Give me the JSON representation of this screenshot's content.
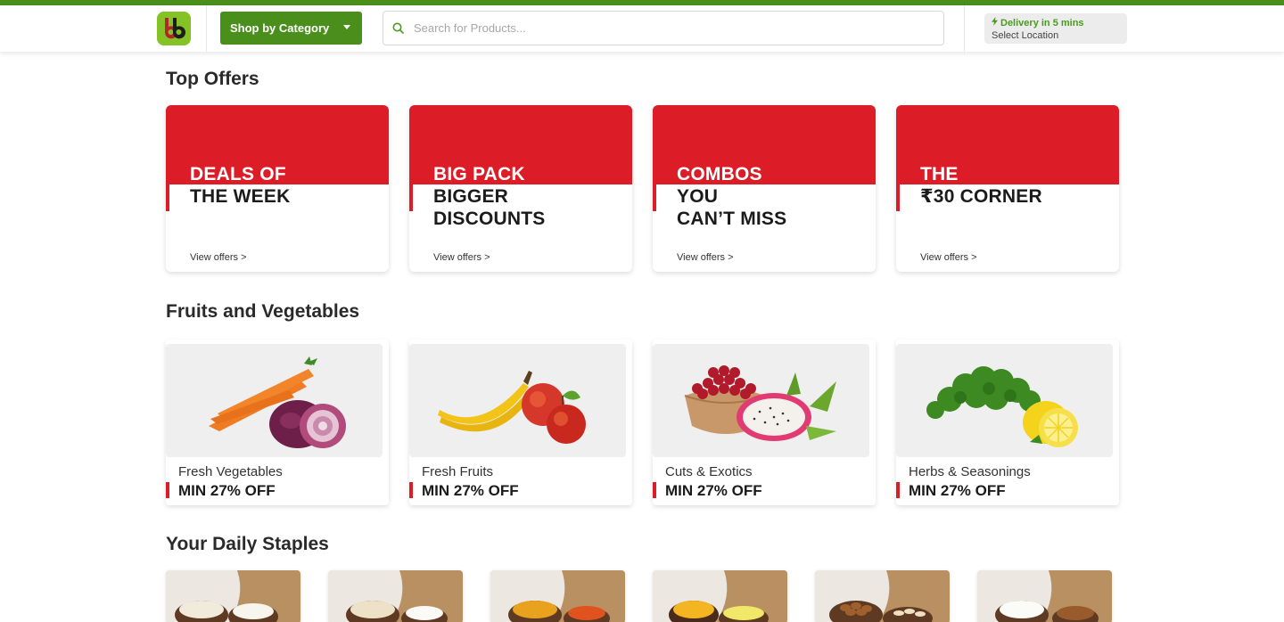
{
  "brand": {
    "logo_name": "bigbasket-logo",
    "accent": "#84c225",
    "topbar": "#4a8f1c",
    "offer_red": "#dc1d27"
  },
  "header": {
    "shop_by_category": "Shop by Category",
    "search_placeholder": "Search for Products...",
    "delivery_text": "Delivery in 5 mins",
    "location_text": "Select Location"
  },
  "top_offers": {
    "title": "Top Offers",
    "cards": [
      {
        "line1": "DEALS OF",
        "line2": "THE WEEK",
        "line3": "",
        "link": "View offers >"
      },
      {
        "line1": "BIG PACK",
        "line2": "BIGGER",
        "line3": "DISCOUNTS",
        "link": "View offers >"
      },
      {
        "line1": "COMBOS",
        "line2": "YOU",
        "line3": "CAN’T MISS",
        "link": "View offers >"
      },
      {
        "line1": "THE",
        "line2": "₹30 CORNER",
        "line3": "",
        "link": "View offers >"
      }
    ]
  },
  "fruits_vegetables": {
    "title": "Fruits and Vegetables",
    "cards": [
      {
        "name": "Fresh Vegetables",
        "offer": "MIN 27% OFF"
      },
      {
        "name": "Fresh Fruits",
        "offer": "MIN 27% OFF"
      },
      {
        "name": "Cuts & Exotics",
        "offer": "MIN 27% OFF"
      },
      {
        "name": "Herbs & Seasonings",
        "offer": "MIN 27% OFF"
      }
    ]
  },
  "daily_staples": {
    "title": "Your Daily Staples"
  }
}
